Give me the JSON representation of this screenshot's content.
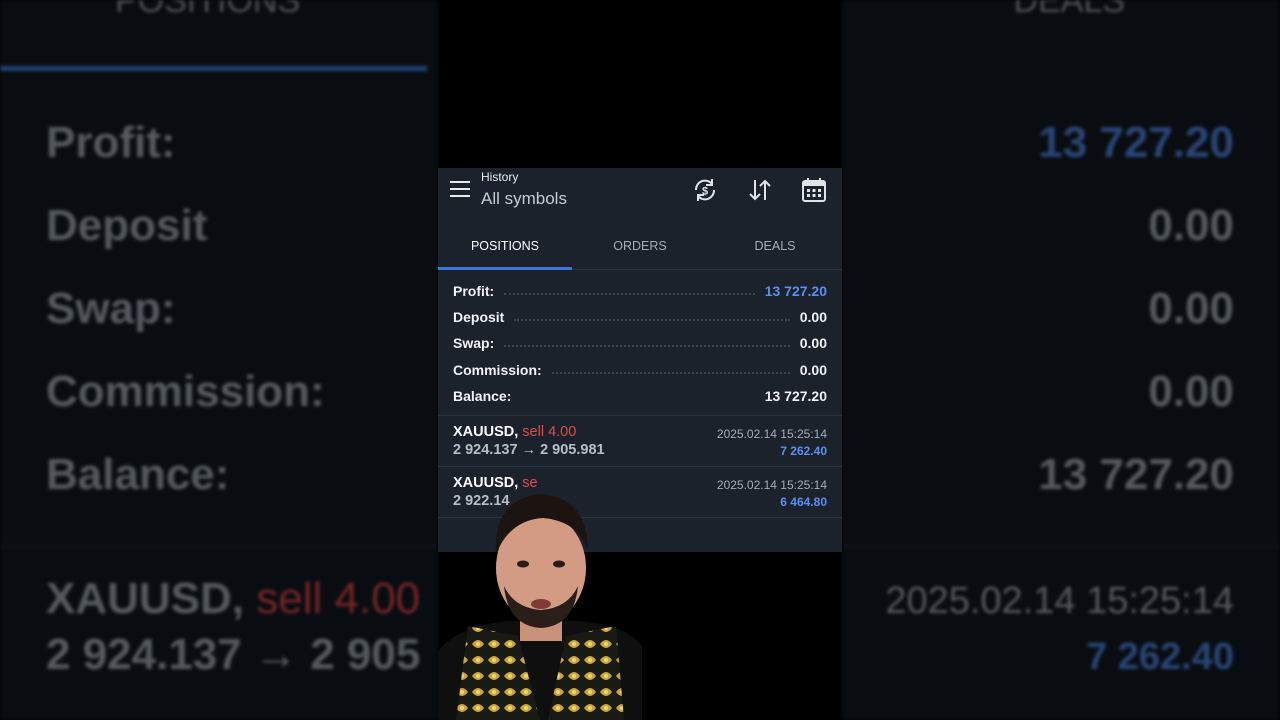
{
  "background": {
    "left": {
      "tab": "POSITIONS",
      "rows": [
        {
          "label": "Profit:"
        },
        {
          "label": "Deposit"
        },
        {
          "label": "Swap:"
        },
        {
          "label": "Commission:"
        },
        {
          "label": "Balance:"
        }
      ],
      "deal_symbol": "XAUUSD,",
      "deal_side": "sell 4.00",
      "deal_price": "2 924.137 → 2 905"
    },
    "right": {
      "tab": "DEALS",
      "values": [
        "13 727.20",
        "0.00",
        "0.00",
        "0.00",
        "13 727.20"
      ],
      "deal_time": "2025.02.14 15:25:14",
      "deal_profit": "7 262.40"
    }
  },
  "header": {
    "title": "History",
    "subtitle": "All symbols",
    "icons": [
      "menu-icon",
      "currency-exchange-icon",
      "sort-icon",
      "calendar-icon"
    ]
  },
  "tabs": [
    {
      "label": "POSITIONS",
      "active": true
    },
    {
      "label": "ORDERS",
      "active": false
    },
    {
      "label": "DEALS",
      "active": false
    }
  ],
  "summary": [
    {
      "label": "Profit:",
      "value": "13 727.20",
      "color": "#5b8ff0"
    },
    {
      "label": "Deposit",
      "value": "0.00"
    },
    {
      "label": "Swap:",
      "value": "0.00"
    },
    {
      "label": "Commission:",
      "value": "0.00"
    },
    {
      "label": "Balance:",
      "value": "13 727.20"
    }
  ],
  "deals": [
    {
      "symbol": "XAUUSD,",
      "side": "sell 4.00",
      "price": "2 924.137 → 2 905.981",
      "time": "2025.02.14 15:25:14",
      "profit": "7 262.40"
    },
    {
      "symbol": "XAUUSD,",
      "side": "se",
      "price": "2 922.14",
      "time": "2025.02.14 15:25:14",
      "profit": "6 464.80"
    }
  ],
  "colors": {
    "accent": "#3f73d6",
    "profit": "#5b8ff0",
    "sell": "#e04b4b",
    "panel": "#1b222c"
  }
}
